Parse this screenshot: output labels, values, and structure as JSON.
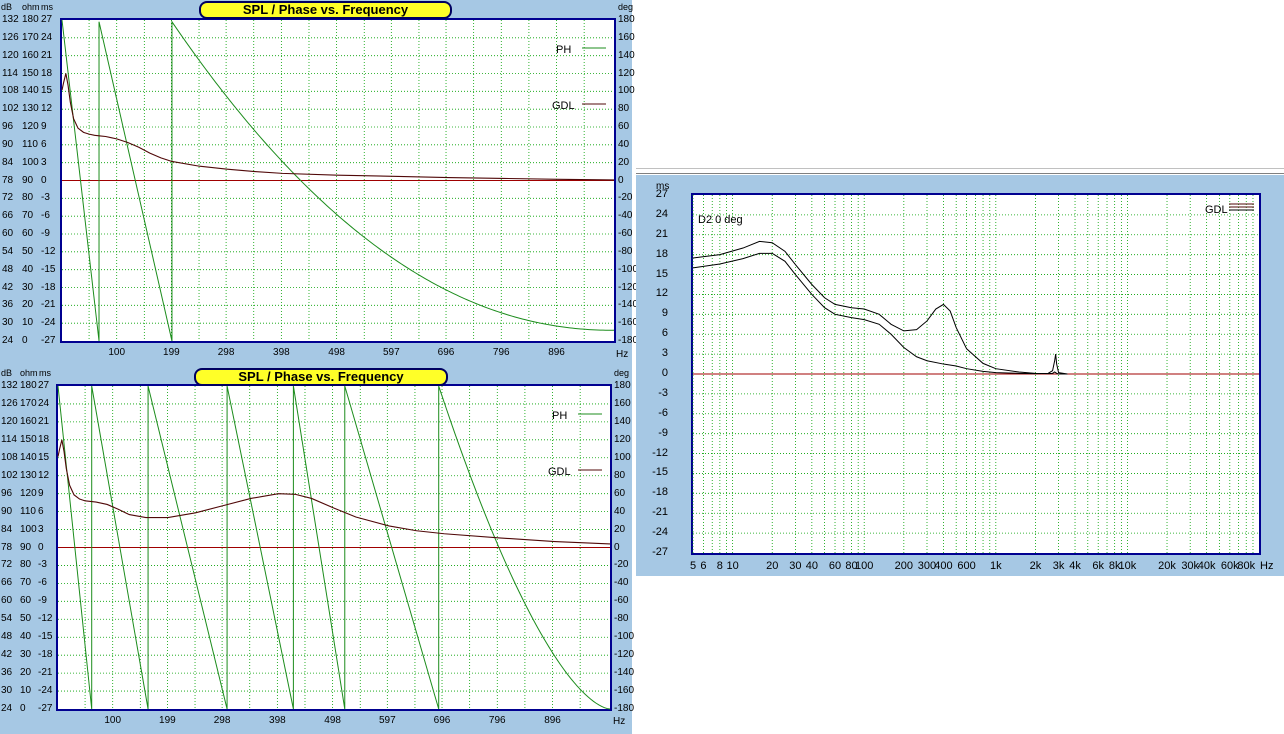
{
  "colors": {
    "panel_bg": "#a6c8e4",
    "frame": "#000090",
    "title_bg": "#ffff28",
    "grid": "#00a000",
    "phase": "#1c8c1c",
    "gdl": "#500808",
    "zero_line": "#a00000"
  },
  "chart_data": [
    {
      "type": "line",
      "title": "SPL / Phase vs. Frequency",
      "units": {
        "db": "dB",
        "ohm": "ohm",
        "ms": "ms",
        "deg": "deg",
        "hz": "Hz"
      },
      "x_ticks": [
        "100",
        "199",
        "298",
        "398",
        "498",
        "597",
        "696",
        "796",
        "896"
      ],
      "xlim": [
        1,
        1000
      ],
      "left_axes": {
        "db": [
          "132",
          "126",
          "120",
          "114",
          "108",
          "102",
          "96",
          "90",
          "84",
          "78",
          "72",
          "66",
          "60",
          "54",
          "48",
          "42",
          "36",
          "30",
          "24"
        ],
        "ohm": [
          "180",
          "170",
          "160",
          "150",
          "140",
          "130",
          "120",
          "110",
          "100",
          "90",
          "80",
          "70",
          "60",
          "50",
          "40",
          "30",
          "20",
          "10",
          "0"
        ],
        "ms": [
          "27",
          "24",
          "21",
          "18",
          "15",
          "12",
          "9",
          "6",
          "3",
          "0",
          "-3",
          "-6",
          "-9",
          "-12",
          "-15",
          "-18",
          "-21",
          "-24",
          "-27"
        ]
      },
      "right_axis": {
        "deg": [
          "180",
          "160",
          "140",
          "120",
          "100",
          "80",
          "60",
          "40",
          "20",
          "0",
          "-20",
          "-40",
          "-60",
          "-80",
          "-100",
          "-120",
          "-140",
          "-160",
          "-180"
        ]
      },
      "ylim_ms": [
        -27,
        27
      ],
      "ylim_deg": [
        -180,
        180
      ],
      "series": [
        {
          "name": "PH",
          "kind": "phase",
          "slope_deg_per_hz": -3.9,
          "start_deg": 178,
          "decay_start_hz": 200,
          "decay_end_hz": 1000,
          "decay_end_deg": -168
        },
        {
          "name": "GDL",
          "kind": "gdl",
          "x": [
            1,
            4,
            8,
            12,
            16,
            22,
            30,
            40,
            50,
            60,
            70,
            80,
            90,
            100,
            120,
            140,
            160,
            180,
            200,
            250,
            300,
            350,
            400,
            500,
            600,
            700,
            800,
            900,
            1000
          ],
          "y": [
            15.2,
            16.5,
            18.0,
            16.0,
            13.2,
            10.4,
            8.8,
            8.1,
            7.8,
            7.6,
            7.5,
            7.4,
            7.2,
            7.0,
            6.4,
            5.6,
            4.6,
            3.8,
            3.2,
            2.4,
            1.9,
            1.5,
            1.2,
            0.9,
            0.7,
            0.5,
            0.35,
            0.2,
            0.1
          ]
        }
      ]
    },
    {
      "type": "line",
      "title": "SPL / Phase vs. Frequency",
      "units": {
        "db": "dB",
        "ohm": "ohm",
        "ms": "ms",
        "deg": "deg",
        "hz": "Hz"
      },
      "x_ticks": [
        "100",
        "199",
        "298",
        "398",
        "498",
        "597",
        "696",
        "796",
        "896"
      ],
      "xlim": [
        1,
        1000
      ],
      "left_axes": {
        "db": [
          "132",
          "126",
          "120",
          "114",
          "108",
          "102",
          "96",
          "90",
          "84",
          "78",
          "72",
          "66",
          "60",
          "54",
          "48",
          "42",
          "36",
          "30",
          "24"
        ],
        "ohm": [
          "180",
          "170",
          "160",
          "150",
          "140",
          "130",
          "120",
          "110",
          "100",
          "90",
          "80",
          "70",
          "60",
          "50",
          "40",
          "30",
          "20",
          "10",
          "0"
        ],
        "ms": [
          "27",
          "24",
          "21",
          "18",
          "15",
          "12",
          "9",
          "6",
          "3",
          "0",
          "-3",
          "-6",
          "-9",
          "-12",
          "-15",
          "-18",
          "-21",
          "-24",
          "-27"
        ]
      },
      "right_axis": {
        "deg": [
          "180",
          "160",
          "140",
          "120",
          "100",
          "80",
          "60",
          "40",
          "20",
          "0",
          "-20",
          "-40",
          "-60",
          "-80",
          "-100",
          "-120",
          "-140",
          "-160",
          "-180"
        ]
      },
      "ylim_ms": [
        -27,
        27
      ],
      "ylim_deg": [
        -180,
        180
      ],
      "series": [
        {
          "name": "PH",
          "kind": "phase",
          "wrap_x": [
            1,
            62,
            164,
            307,
            427,
            520,
            690
          ],
          "end_deg": -180
        },
        {
          "name": "GDL",
          "kind": "gdl",
          "x": [
            1,
            4,
            8,
            12,
            16,
            22,
            30,
            40,
            50,
            70,
            90,
            110,
            130,
            160,
            200,
            250,
            300,
            350,
            400,
            430,
            460,
            500,
            540,
            600,
            650,
            700,
            800,
            900,
            1000
          ],
          "y": [
            15.2,
            16.5,
            18.0,
            16.0,
            13.2,
            10.4,
            8.8,
            8.1,
            7.8,
            7.6,
            7.2,
            6.4,
            5.5,
            5.0,
            5.0,
            5.8,
            7.0,
            8.2,
            9.0,
            8.9,
            8.2,
            6.6,
            5.1,
            3.6,
            2.8,
            2.3,
            1.6,
            1.0,
            0.6
          ]
        }
      ]
    },
    {
      "type": "line",
      "log_x": true,
      "annotation": "D2 0 deg",
      "units": {
        "ms": "ms",
        "hz": "Hz"
      },
      "x_ticks": [
        "5",
        "6",
        "8",
        "10",
        "20",
        "30",
        "40",
        "60",
        "80",
        "100",
        "200",
        "300",
        "400",
        "600",
        "1k",
        "2k",
        "3k",
        "4k",
        "6k",
        "8k",
        "10k",
        "20k",
        "30k",
        "40k",
        "60k",
        "80k"
      ],
      "x_tick_values": [
        5,
        6,
        8,
        10,
        20,
        30,
        40,
        60,
        80,
        100,
        200,
        300,
        400,
        600,
        1000,
        2000,
        3000,
        4000,
        6000,
        8000,
        10000,
        20000,
        30000,
        40000,
        60000,
        80000
      ],
      "xlim": [
        5,
        100000
      ],
      "y_ticks": [
        "27",
        "24",
        "21",
        "18",
        "15",
        "12",
        "9",
        "6",
        "3",
        "0",
        "-3",
        "-6",
        "-9",
        "-12",
        "-15",
        "-18",
        "-21",
        "-24",
        "-27"
      ],
      "ylim": [
        -27,
        27
      ],
      "series": [
        {
          "name": "GDL",
          "kind": "gdl",
          "x": [
            5,
            8,
            12,
            16,
            20,
            25,
            30,
            40,
            50,
            60,
            80,
            100,
            130,
            160,
            200,
            250,
            300,
            350,
            400,
            450,
            500,
            600,
            800,
            1000,
            1500,
            2000,
            2500,
            2700,
            2800,
            2900,
            3000,
            3500
          ],
          "y": [
            17.5,
            18.0,
            19.0,
            20.0,
            19.8,
            18.5,
            16.5,
            13.5,
            11.5,
            10.5,
            10.0,
            9.8,
            9.0,
            7.5,
            6.5,
            6.7,
            8.0,
            9.8,
            10.5,
            9.5,
            7.0,
            3.8,
            1.6,
            0.8,
            0.3,
            0.1,
            0.05,
            0.1,
            0.3,
            0.1,
            0.0,
            0.0
          ]
        },
        {
          "name": "GDL",
          "kind": "gdl2",
          "x": [
            5,
            8,
            12,
            16,
            20,
            25,
            30,
            40,
            50,
            60,
            80,
            100,
            130,
            160,
            200,
            250,
            300,
            400,
            500,
            600,
            800,
            1000,
            1500,
            2000,
            2500,
            2700,
            2800,
            2850,
            2900,
            3000,
            3500
          ],
          "y": [
            16.0,
            16.6,
            17.4,
            18.2,
            18.2,
            17.0,
            15.0,
            12.0,
            10.0,
            9.0,
            8.5,
            8.2,
            7.5,
            6.0,
            4.0,
            2.6,
            2.0,
            1.5,
            1.2,
            0.8,
            0.4,
            0.2,
            0.1,
            0.05,
            0.1,
            0.5,
            2.0,
            3.0,
            1.5,
            0.2,
            0.0
          ]
        }
      ]
    }
  ],
  "legend": {
    "ph": "PH",
    "gdl": "GDL"
  }
}
